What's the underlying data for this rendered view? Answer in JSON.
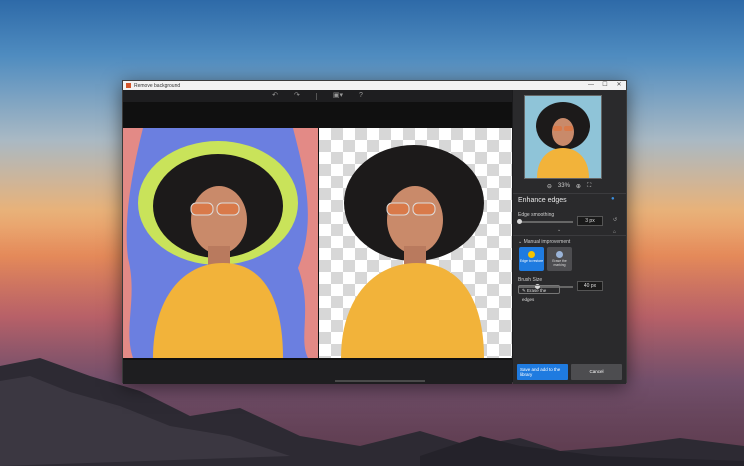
{
  "window": {
    "title": "Remove background",
    "controls": {
      "minimize": "—",
      "maximize": "☐",
      "close": "✕"
    }
  },
  "toolbar": {
    "undo_icon": "undo-icon",
    "redo_icon": "redo-icon",
    "compare_icon": "compare-view-icon",
    "dropdown_icon": "chevron-down-icon",
    "help": "?"
  },
  "preview": {
    "zoom_out_icon": "zoom-out-icon",
    "zoom_level": "33%",
    "zoom_in_icon": "zoom-in-icon",
    "fit_icon": "fit-screen-icon"
  },
  "enhance_edges": {
    "title": "Enhance edges",
    "edge_smoothing_label": "Edge smoothing",
    "edge_smoothing_value": "3 px",
    "edge_smoothing_fraction": 0.05
  },
  "manual_improvement": {
    "title": "Manual improvement",
    "modes": [
      {
        "label": "Edge to restore",
        "active": true
      },
      {
        "label": "Erase the marking",
        "active": false
      }
    ],
    "brush_size_label": "Brush Size",
    "brush_size_value": "40 px",
    "brush_size_fraction": 0.35,
    "erase_button": "Erase the edges"
  },
  "actions": {
    "save_label": "Save and add to the library",
    "cancel_label": "Cancel"
  },
  "colors": {
    "accent": "#1f7be0",
    "edge_highlight": "#c9e35a",
    "mask_blue": "#6b7fe0",
    "mask_pink": "#e38a86",
    "sweater": "#f2b33a"
  }
}
